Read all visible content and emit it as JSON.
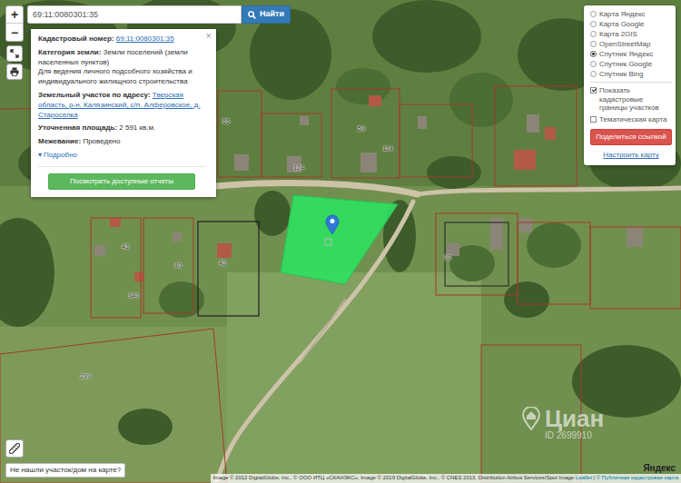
{
  "search": {
    "value": "69:11:0080301:35",
    "button": "Найти"
  },
  "map_controls": {
    "zoom_in": "+",
    "zoom_out": "−"
  },
  "map": {
    "selected_parcel": {
      "highlighted": true
    },
    "parcel_labels": [
      "55",
      "124",
      "53",
      "114",
      "43",
      "42",
      "340",
      "40",
      "38",
      "239"
    ]
  },
  "popup": {
    "close": "×",
    "cadastral_number": {
      "label": "Кадастровый номер:",
      "value": "69:11:0080301:35"
    },
    "category": {
      "label": "Категория земли:",
      "value": "Земли поселений (земли населенных пунктов)",
      "purpose": "Для ведения личного подсобного хозяйства и индивидуального жилищного строительства"
    },
    "address": {
      "label": "Земельный участок по адресу:",
      "value": "Тверская область, р-н. Калязинский, с/п. Алферовское, д. Староселка"
    },
    "area": {
      "label": "Уточненная площадь:",
      "value": "2 591 кв.м."
    },
    "survey": {
      "label": "Межевание:",
      "value": "Проведено"
    },
    "details": {
      "icon": "▾",
      "label": "Подробно",
      "expanded": false
    },
    "button": "Посмотреть доступные отчеты"
  },
  "layers": {
    "base": [
      {
        "label": "Карта Яндекс",
        "selected": false
      },
      {
        "label": "Карта Google",
        "selected": false
      },
      {
        "label": "Карта 2GIS",
        "selected": false
      },
      {
        "label": "OpenStreetMap",
        "selected": false
      },
      {
        "label": "Спутник Яндекс",
        "selected": true
      },
      {
        "label": "Спутник Google",
        "selected": false
      },
      {
        "label": "Спутник Bing",
        "selected": false
      }
    ],
    "overlays": [
      {
        "label": "Показать кадастровые границы участков",
        "checked": true
      },
      {
        "label": "Тематическая карта",
        "checked": false
      }
    ],
    "share": "Поделиться ссылкой",
    "settings": "Настроить карту"
  },
  "help": "Не нашли участок/дом на карте?",
  "logo": "Яндекс",
  "watermark": {
    "name": "Циан",
    "id": "ID 2699910"
  },
  "attribution": {
    "imagery": "Image © 2012 DigitalGlobe, Inc., © ООО ИТЦ «СКАНЭКС», Image © 2019 DigitalGlobe, Inc., © CNES 2013, Distribution Airbus Services/Spot Image",
    "leaflet": "Leaflet",
    "separator": "|",
    "source": "© Публичная кадастровая карта"
  }
}
